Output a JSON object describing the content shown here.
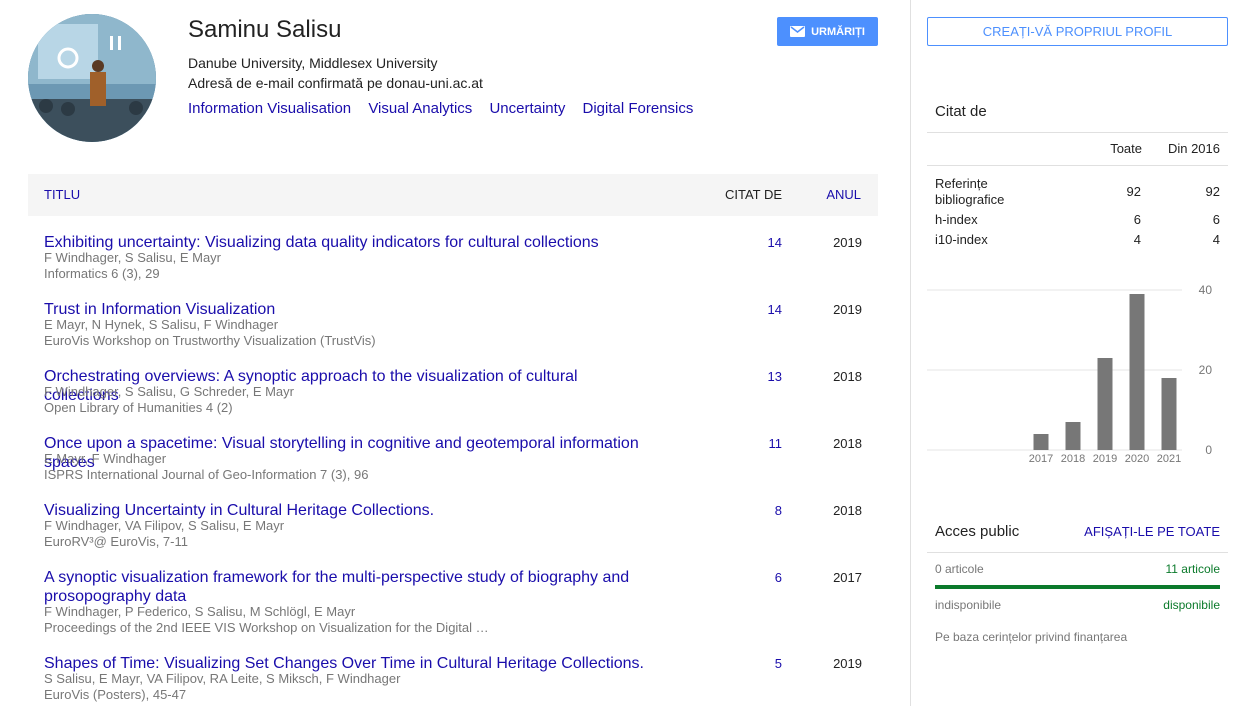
{
  "profile": {
    "name": "Saminu Salisu",
    "affiliation": "Danube University, Middlesex University",
    "email": "Adresă de e-mail confirmată pe donau-uni.ac.at",
    "interests": [
      "Information Visualisation",
      "Visual Analytics",
      "Uncertainty",
      "Digital Forensics"
    ]
  },
  "follow_button": {
    "label": "URMĂRIȚI",
    "icon": "mail-icon",
    "color": "#4d90fe"
  },
  "create_profile_button": {
    "label": "CREAȚI-VĂ PROPRIUL PROFIL"
  },
  "table": {
    "headers": {
      "title": "TITLU",
      "cited_by": "CITAT DE",
      "year": "ANUL"
    },
    "articles": [
      {
        "title": "Exhibiting uncertainty: Visualizing data quality indicators for cultural collections",
        "authors": "F Windhager, S Salisu, E Mayr",
        "publication": "Informatics 6 (3), 29",
        "cited_by": "14",
        "year": "2019"
      },
      {
        "title": "Trust in Information Visualization",
        "authors": "E Mayr, N Hynek, S Salisu, F Windhager",
        "publication": "EuroVis Workshop on Trustworthy Visualization (TrustVis)",
        "cited_by": "14",
        "year": "2019"
      },
      {
        "title": "Orchestrating overviews: A synoptic approach to the visualization of cultural collections",
        "authors": "F Windhager, S Salisu, G Schreder, E Mayr",
        "publication": "Open Library of Humanities 4 (2)",
        "cited_by": "13",
        "year": "2018"
      },
      {
        "title": "Once upon a spacetime: Visual storytelling in cognitive and geotemporal information spaces",
        "authors": "E Mayr, F Windhager",
        "publication": "ISPRS International Journal of Geo-Information 7 (3), 96",
        "cited_by": "11",
        "year": "2018"
      },
      {
        "title": "Visualizing Uncertainty in Cultural Heritage Collections.",
        "authors": "F Windhager, VA Filipov, S Salisu, E Mayr",
        "publication": "EuroRV³@ EuroVis, 7-11",
        "cited_by": "8",
        "year": "2018"
      },
      {
        "title": "A synoptic visualization framework for the multi-perspective study of biography and prosopography data",
        "authors": "F Windhager, P Federico, S Salisu, M Schlögl, E Mayr",
        "publication": "Proceedings of the 2nd IEEE VIS Workshop on Visualization for the Digital …",
        "cited_by": "6",
        "year": "2017"
      },
      {
        "title": "Shapes of Time: Visualizing Set Changes Over Time in Cultural Heritage Collections.",
        "authors": "S Salisu, E Mayr, VA Filipov, RA Leite, S Miksch, F Windhager",
        "publication": "EuroVis (Posters), 45-47",
        "cited_by": "5",
        "year": "2019"
      }
    ]
  },
  "cited_by": {
    "title": "Citat de",
    "col_all": "Toate",
    "col_since": "Din 2016",
    "rows": [
      {
        "label": "Referințe bibliografice",
        "all": "92",
        "since": "92"
      },
      {
        "label": "h-index",
        "all": "6",
        "since": "6"
      },
      {
        "label": "i10-index",
        "all": "4",
        "since": "4"
      }
    ]
  },
  "chart_data": {
    "type": "bar",
    "categories": [
      "2017",
      "2018",
      "2019",
      "2020",
      "2021"
    ],
    "values": [
      4,
      7,
      23,
      39,
      18
    ],
    "ylim": [
      0,
      40
    ],
    "yticks": [
      "0",
      "20",
      "40"
    ],
    "bar_color": "#777777"
  },
  "public_access": {
    "title": "Acces public",
    "link": "AFIȘAȚI-LE PE TOATE",
    "unavailable_count": "0 articole",
    "available_count": "11 articole",
    "unavailable_label": "indisponibile",
    "available_label": "disponibile",
    "available_fraction": 1.0,
    "note": "Pe baza cerințelor privind finanțarea"
  }
}
